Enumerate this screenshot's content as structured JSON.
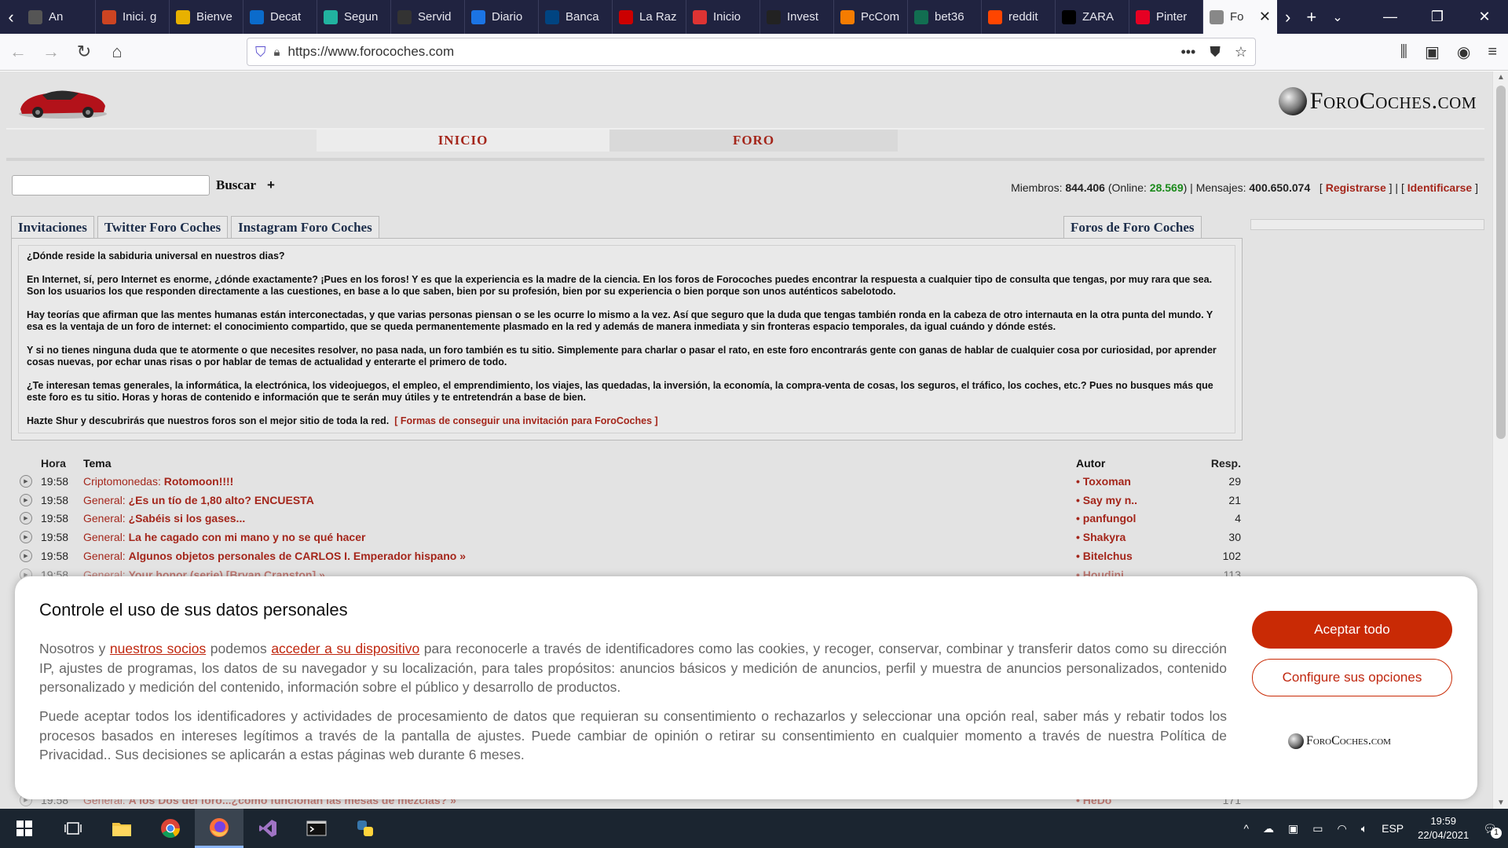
{
  "browser": {
    "tabs": [
      {
        "label": "An",
        "color": "#555"
      },
      {
        "label": "Inici. g",
        "color": "#c42"
      },
      {
        "label": "Bienve",
        "color": "#e8b100"
      },
      {
        "label": "Decat",
        "color": "#0b6bcb"
      },
      {
        "label": "Segun",
        "color": "#21b3a0"
      },
      {
        "label": "Servid",
        "color": "#333"
      },
      {
        "label": "Diario",
        "color": "#1b74e4"
      },
      {
        "label": "Banca",
        "color": "#004481"
      },
      {
        "label": "La Raz",
        "color": "#c00"
      },
      {
        "label": "Inicio",
        "color": "#d33"
      },
      {
        "label": "Invest",
        "color": "#222"
      },
      {
        "label": "PcCom",
        "color": "#f57c00"
      },
      {
        "label": "bet36",
        "color": "#126e51"
      },
      {
        "label": "reddit",
        "color": "#ff4500"
      },
      {
        "label": "ZARA",
        "color": "#000"
      },
      {
        "label": "Pinter",
        "color": "#e60023"
      },
      {
        "label": "Fo",
        "color": "#888"
      }
    ],
    "url": "https://www.forocoches.com"
  },
  "site": {
    "brand": "ForoCoches.com",
    "nav": {
      "inicio": "INICIO",
      "foro": "FORO"
    },
    "search_button": "Buscar",
    "plus": "+",
    "stats": {
      "members_label": "Miembros:",
      "members": "844.406",
      "online_label": "(Online:",
      "online": "28.569",
      "messages_label": ") | Mensajes:",
      "messages": "400.650.074",
      "register": "Registrarse",
      "login": "Identificarse"
    },
    "tabs": [
      "Invitaciones",
      "Twitter Foro Coches",
      "Instagram Foro Coches"
    ],
    "right_tab": "Foros de Foro Coches",
    "intro": {
      "p1": "¿Dónde reside la sabiduria universal en nuestros dias?",
      "p2": "En Internet, sí, pero Internet es enorme, ¿dónde exactamente? ¡Pues en los foros! Y es que la experiencia es la madre de la ciencia. En los foros de Forocoches puedes encontrar la respuesta a cualquier tipo de consulta que tengas, por muy rara que sea. Son los usuarios los que responden directamente a las cuestiones, en base a lo que saben, bien por su profesión, bien por su experiencia o bien porque son unos auténticos sabelotodo.",
      "p3": "Hay teorías que afirman que las mentes humanas están interconectadas, y que varias personas piensan o se les ocurre lo mismo a la vez. Así que seguro que la duda que tengas también ronda en la cabeza de otro internauta en la otra punta del mundo. Y esa es la ventaja de un foro de internet: el conocimiento compartido, que se queda permanentemente plasmado en la red y además de manera inmediata y sin fronteras espacio temporales, da igual cuándo y dónde estés.",
      "p4": "Y si no tienes ninguna duda que te atormente o que necesites resolver, no pasa nada, un foro también es tu sitio. Simplemente para charlar o pasar el rato, en este foro encontrarás gente con ganas de hablar de cualquier cosa por curiosidad, por aprender cosas nuevas, por echar unas risas o por hablar de temas de actualidad y enterarte el primero de todo.",
      "p5": "¿Te interesan temas generales, la informática, la electrónica, los videojuegos, el empleo, el emprendimiento, los viajes, las quedadas, la inversión, la economía, la compra-venta de cosas, los seguros, el tráfico, los coches, etc.? Pues no busques más que este foro es tu sitio. Horas y horas de contenido e información que te serán muy útiles y te entretendrán a base de bien.",
      "p6": "Hazte Shur y descubrirás que nuestros foros son el mejor sitio de toda la red.",
      "invite_link": "[ Formas de conseguir una invitación para ForoCoches ]"
    },
    "threads_header": {
      "hora": "Hora",
      "tema": "Tema",
      "autor": "Autor",
      "resp": "Resp."
    },
    "threads": [
      {
        "hora": "19:58",
        "cat": "Criptomonedas:",
        "title": "Rotomoon!!!!",
        "autor": "Toxoman",
        "resp": "29"
      },
      {
        "hora": "19:58",
        "cat": "General:",
        "title": "¿Es un tío de 1,80 alto? ENCUESTA",
        "autor": "Say my n..",
        "resp": "21"
      },
      {
        "hora": "19:58",
        "cat": "General:",
        "title": "¿Sabéis si los gases...",
        "autor": "panfungol",
        "resp": "4"
      },
      {
        "hora": "19:58",
        "cat": "General:",
        "title": "La he cagado con mi mano y no se qué hacer",
        "autor": "Shakyra",
        "resp": "30"
      },
      {
        "hora": "19:58",
        "cat": "General:",
        "title": "Algunos objetos personales de CARLOS I. Emperador hispano »",
        "autor": "Bitelchus",
        "resp": "102"
      },
      {
        "hora": "19:58",
        "cat": "General:",
        "title": "Your honor (serie) [Bryan Cranston] »",
        "autor": "Houdini",
        "resp": "113"
      }
    ],
    "bottom_thread": {
      "hora": "19:58",
      "cat": "General:",
      "title": "A los Dos del foro...¿cómo funcionan las mesas de mezclas? »",
      "autor": "HeDo",
      "resp": "171"
    }
  },
  "consent": {
    "title": "Controle el uso de sus datos personales",
    "p1_a": "Nosotros y ",
    "p1_link1": "nuestros socios",
    "p1_b": " podemos ",
    "p1_link2": "acceder a su dispositivo",
    "p1_c": " para reconocerle a través de identificadores como las cookies, y recoger, conservar, combinar y transferir datos como su dirección IP, ajustes de programas, los datos de su navegador y su localización, para tales propósitos: anuncios básicos y medición de anuncios, perfil y muestra de anuncios personalizados, contenido personalizado y medición del contenido, información sobre el público y desarrollo de productos.",
    "p2": "Puede aceptar todos los identificadores y actividades de procesamiento de datos que requieran su consentimiento o rechazarlos y seleccionar una opción real, saber más y rebatir todos los procesos basados en intereses legítimos a través de la pantalla de ajustes. Puede cambiar de opinión o retirar su consentimiento en cualquier momento a través de nuestra Política de Privacidad.. Sus decisiones se aplicarán a estas páginas web durante 6 meses.",
    "accept": "Aceptar todo",
    "configure": "Configure sus opciones",
    "brand": "ForoCoches.com"
  },
  "taskbar": {
    "lang": "ESP",
    "time": "19:59",
    "date": "22/04/2021",
    "notif": "1"
  }
}
